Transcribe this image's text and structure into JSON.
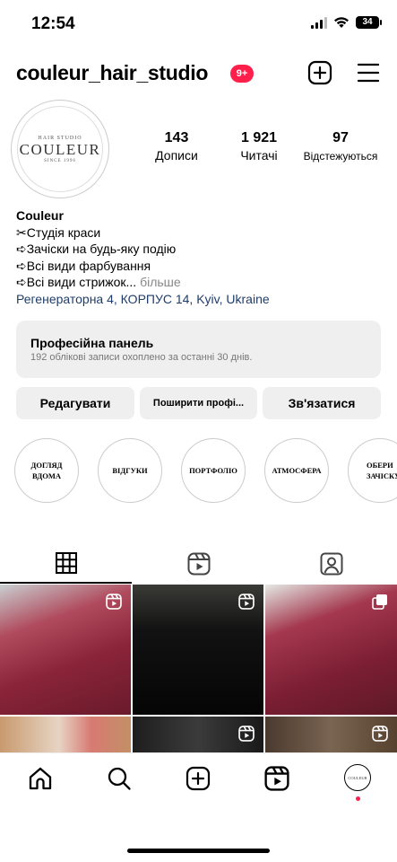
{
  "status_bar": {
    "time": "12:54",
    "battery": "34"
  },
  "header": {
    "username": "couleur_hair_studio",
    "notification_badge": "9+",
    "icons": [
      "new-post-icon",
      "menu-icon"
    ]
  },
  "avatar": {
    "logo_top": "HAIR STUDIO",
    "logo_main": "COULEUR",
    "logo_bottom": "SINCE 1996"
  },
  "stats": [
    {
      "value": "143",
      "label": "Дописи"
    },
    {
      "value": "1 921",
      "label": "Читачі"
    },
    {
      "value": "97",
      "label": "Відстежуються"
    }
  ],
  "bio": {
    "name": "Couleur",
    "lines": [
      "✂Студія краси",
      "➪Зачіски на будь-яку подію",
      "➪Всі види фарбування",
      "➪Всі види стрижок..."
    ],
    "more": "більше",
    "location": "Регенераторна 4, КОРПУС 14, Kyiv, Ukraine"
  },
  "pro_panel": {
    "title": "Професійна панель",
    "subtitle": "192 облікові записи охоплено за останні 30 днів."
  },
  "actions": {
    "edit": "Редагувати",
    "share": "Поширити профі...",
    "contact": "Зв'язатися"
  },
  "highlights": [
    {
      "l1": "ДОГЛЯД",
      "l2": "ВДОМА"
    },
    {
      "l1": "ВІДГУКИ",
      "l2": ""
    },
    {
      "l1": "ПОРТФОЛІО",
      "l2": ""
    },
    {
      "l1": "АТМОСФЕРА",
      "l2": ""
    },
    {
      "l1": "ОБЕРИ",
      "l2": "ЗАЧІСКУ"
    }
  ],
  "tabs": [
    "grid-icon",
    "reels-icon",
    "tagged-icon"
  ],
  "bottom_nav": [
    "home-icon",
    "search-icon",
    "create-icon",
    "reels-icon",
    "profile-avatar"
  ],
  "colors": {
    "accent": "#ff1f4b",
    "location_link": "#1f3d6b",
    "panel_bg": "#efefef"
  }
}
